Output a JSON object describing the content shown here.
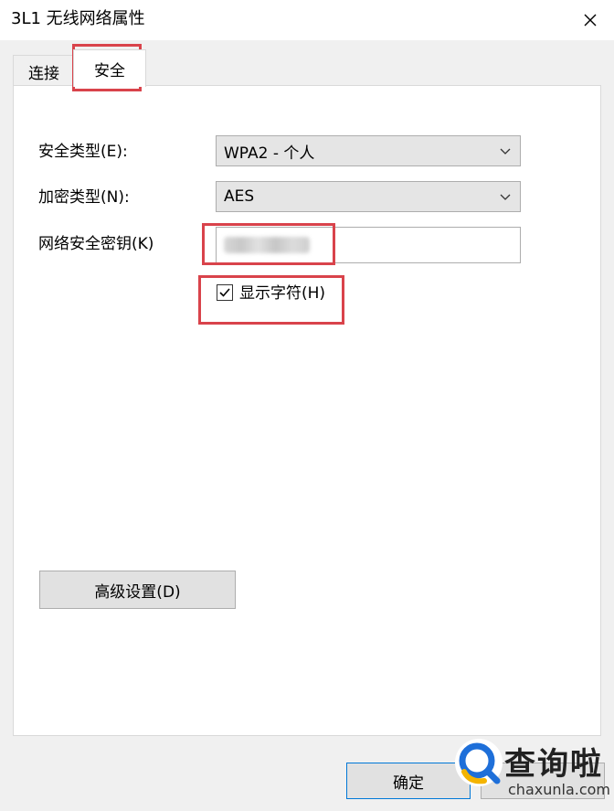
{
  "window": {
    "title": "3L1 无线网络属性"
  },
  "tabs": [
    {
      "label": "连接"
    },
    {
      "label": "安全"
    }
  ],
  "security": {
    "type_label": "安全类型(E):",
    "type_value": "WPA2 - 个人",
    "encryption_label": "加密类型(N):",
    "encryption_value": "AES",
    "key_label": "网络安全密钥(K)",
    "show_chars_label": "显示字符(H)",
    "show_chars_checked": true
  },
  "buttons": {
    "advanced": "高级设置(D)",
    "ok": "确定"
  },
  "watermark": {
    "brand": "查询啦",
    "domain": "chaxunla.com"
  },
  "colors": {
    "highlight": "#d9434b",
    "watermark_accent": "#1e6fd9",
    "watermark_ring": "#f4b400"
  }
}
